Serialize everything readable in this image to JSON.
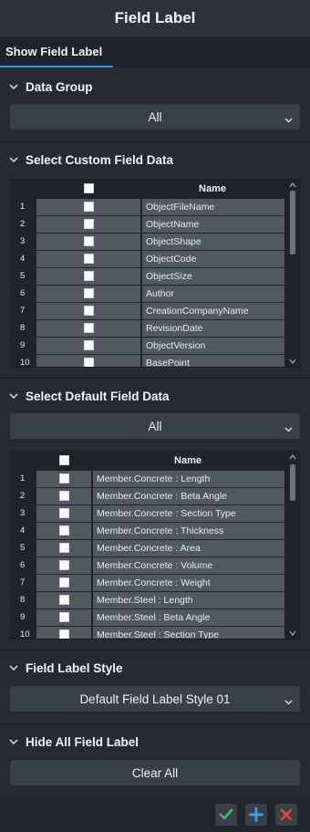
{
  "window": {
    "title": "Field Label"
  },
  "tabs": [
    {
      "label": "Show Field Label"
    }
  ],
  "data_group": {
    "heading": "Data Group",
    "selected": "All"
  },
  "custom_field": {
    "heading": "Select Custom Field Data",
    "column_name": "Name",
    "rows": [
      {
        "num": "1",
        "name": "ObjectFileName"
      },
      {
        "num": "2",
        "name": "ObjectName"
      },
      {
        "num": "3",
        "name": "ObjectShape"
      },
      {
        "num": "4",
        "name": "ObjectCode"
      },
      {
        "num": "5",
        "name": "ObjectSize"
      },
      {
        "num": "6",
        "name": "Author"
      },
      {
        "num": "7",
        "name": "CreationCompanyName"
      },
      {
        "num": "8",
        "name": "RevisionDate"
      },
      {
        "num": "9",
        "name": "ObjectVersion"
      },
      {
        "num": "10",
        "name": "BasePoint"
      }
    ]
  },
  "default_field": {
    "heading": "Select Default Field Data",
    "selected": "All",
    "column_name": "Name",
    "rows": [
      {
        "num": "1",
        "name": "Member.Concrete : Length"
      },
      {
        "num": "2",
        "name": "Member.Concrete : Beta Angle"
      },
      {
        "num": "3",
        "name": "Member.Concrete : Section Type"
      },
      {
        "num": "4",
        "name": "Member.Concrete : Thickness"
      },
      {
        "num": "5",
        "name": "Member.Concrete : Area"
      },
      {
        "num": "6",
        "name": "Member.Concrete : Volume"
      },
      {
        "num": "7",
        "name": "Member.Concrete : Weight"
      },
      {
        "num": "8",
        "name": "Member.Steel : Length"
      },
      {
        "num": "9",
        "name": "Member.Steel : Beta Angle"
      },
      {
        "num": "10",
        "name": "Member.Steel : Section Type"
      }
    ]
  },
  "label_style": {
    "heading": "Field Label Style",
    "selected": "Default Field Label Style 01"
  },
  "hide_all": {
    "heading": "Hide All Field Label",
    "clear_label": "Clear All"
  },
  "colors": {
    "accent": "#3a8ee6",
    "ok": "#3fbf5a",
    "add": "#3aa0f0",
    "cancel": "#e8433e"
  }
}
